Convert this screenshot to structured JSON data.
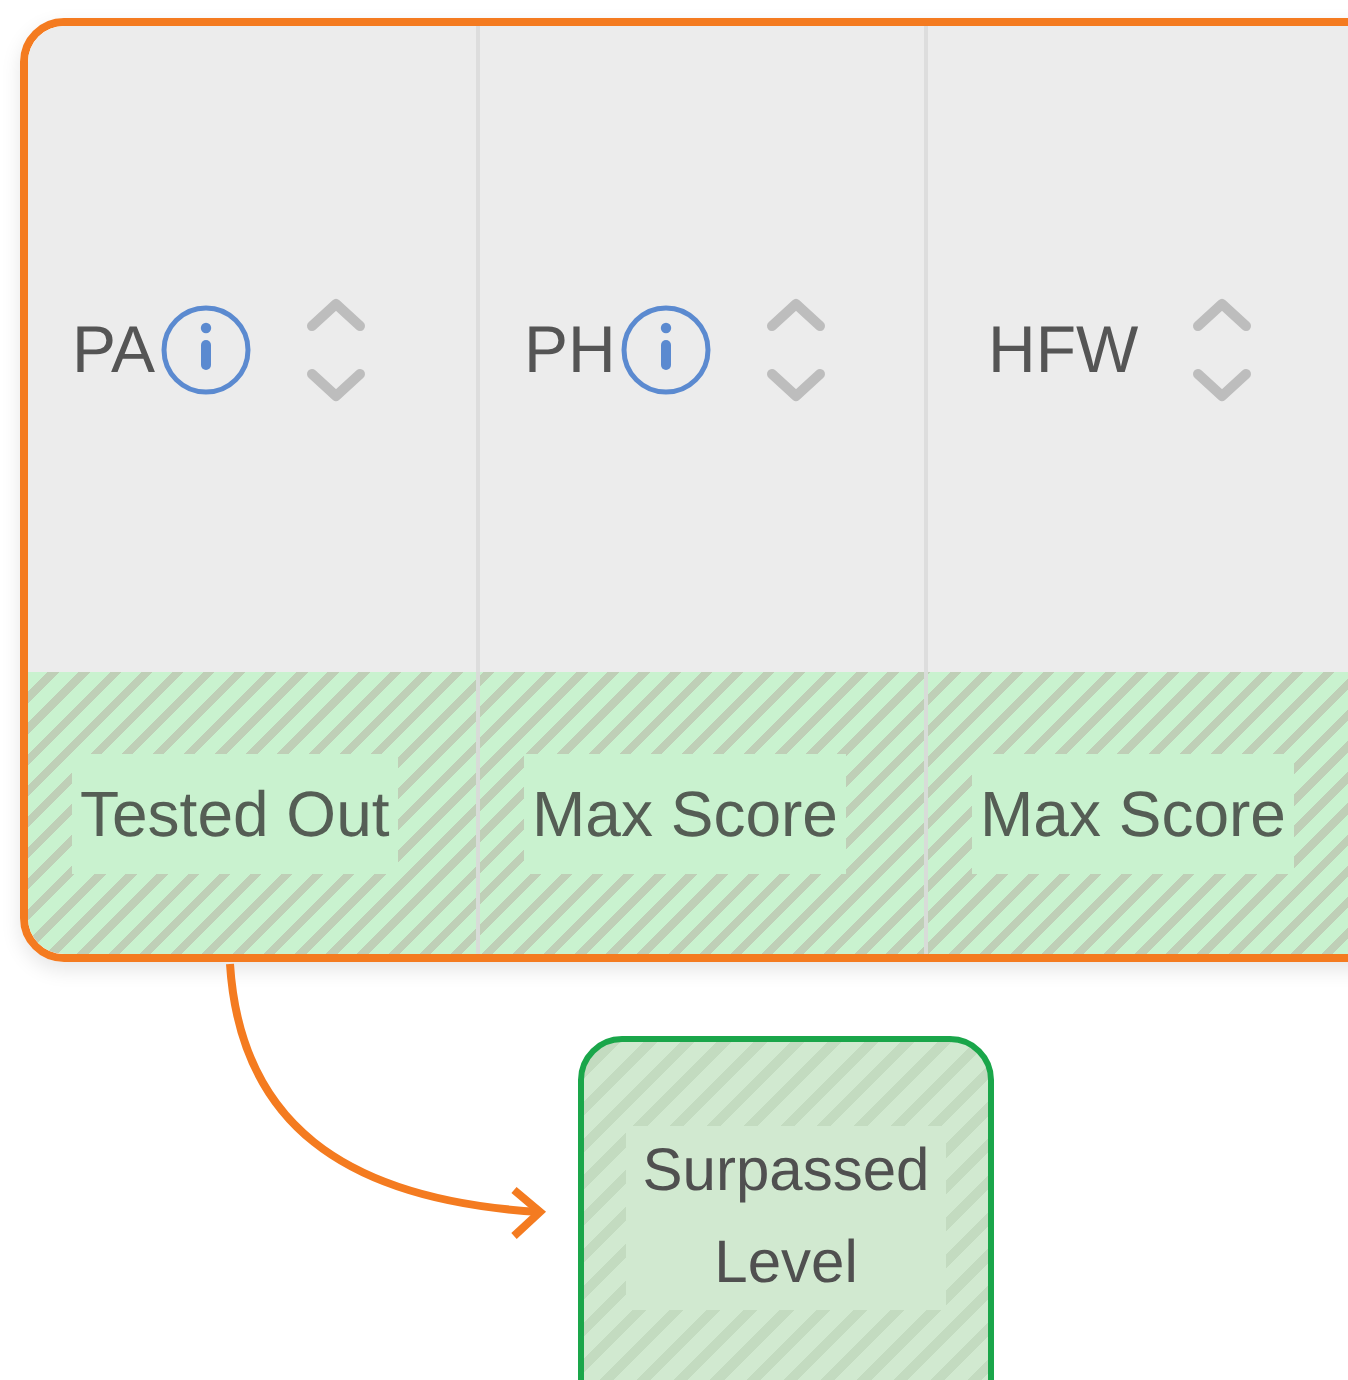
{
  "columns": [
    {
      "label": "PA",
      "info": true
    },
    {
      "label": "PH",
      "info": true
    },
    {
      "label": "HFW",
      "info": false
    }
  ],
  "row": [
    "Tested Out",
    "Max Score",
    "Max Score"
  ],
  "legend": {
    "label": "Surpassed Level"
  }
}
